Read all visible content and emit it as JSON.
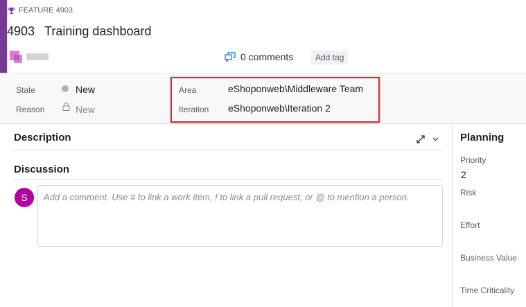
{
  "header": {
    "type_label": "FEATURE 4903",
    "work_item_id": "4903",
    "title": "Training dashboard",
    "comments_label": "0 comments",
    "add_tag_label": "Add tag"
  },
  "fields": {
    "state_label": "State",
    "state_value": "New",
    "reason_label": "Reason",
    "reason_value": "New",
    "area_label": "Area",
    "area_value": "eShoponweb\\Middleware Team",
    "iteration_label": "Iteration",
    "iteration_value": "eShoponweb\\Iteration 2"
  },
  "main": {
    "description_title": "Description",
    "discussion_title": "Discussion",
    "user_initial": "S",
    "comment_placeholder": "Add a comment. Use # to link a work item, ! to link a pull request, or @ to mention a person."
  },
  "planning": {
    "title": "Planning",
    "priority_label": "Priority",
    "priority_value": "2",
    "risk_label": "Risk",
    "effort_label": "Effort",
    "business_value_label": "Business Value",
    "time_criticality_label": "Time Criticality"
  },
  "colors": {
    "accent": "#773b93",
    "highlight_border": "#e0292a",
    "user_avatar": "#b4009e"
  }
}
